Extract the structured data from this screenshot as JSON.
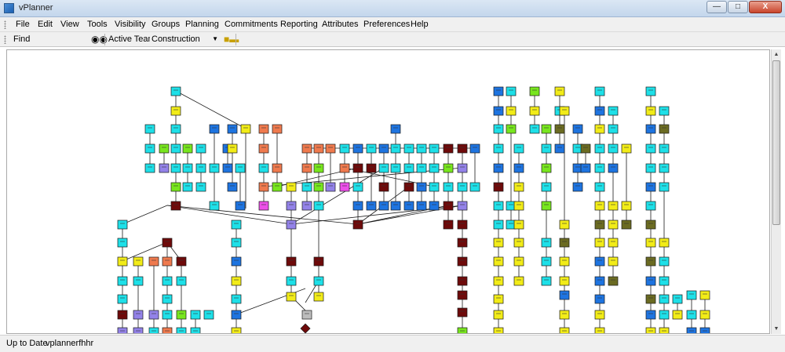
{
  "window": {
    "title": "vPlanner",
    "minimize": "—",
    "maximize": "□",
    "close": "X"
  },
  "menu": [
    "File",
    "Edit",
    "View",
    "Tools",
    "Visibility",
    "Groups",
    "Planning",
    "Commitments",
    "Reporting",
    "Attributes",
    "Preferences",
    "Help"
  ],
  "toolbar": {
    "find_label": "Find",
    "find_value": "",
    "active_team_label": "Active Team",
    "active_team_value": "Construction"
  },
  "status": {
    "state": "Up to Date",
    "user": "vplannerfhhr"
  },
  "icons": {
    "find": "binoculars-icon",
    "team": "team-assign-icon"
  },
  "colors": {
    "cyan": "#1ee0e8",
    "blue": "#1e74e0",
    "yellow": "#f2ec18",
    "green": "#78e61e",
    "maroon": "#6e0a0a",
    "orange": "#ef7a4e",
    "purple": "#9382e8",
    "magenta": "#ec4fe8",
    "olive": "#6b6b22",
    "gray": "#bdbdbd"
  }
}
